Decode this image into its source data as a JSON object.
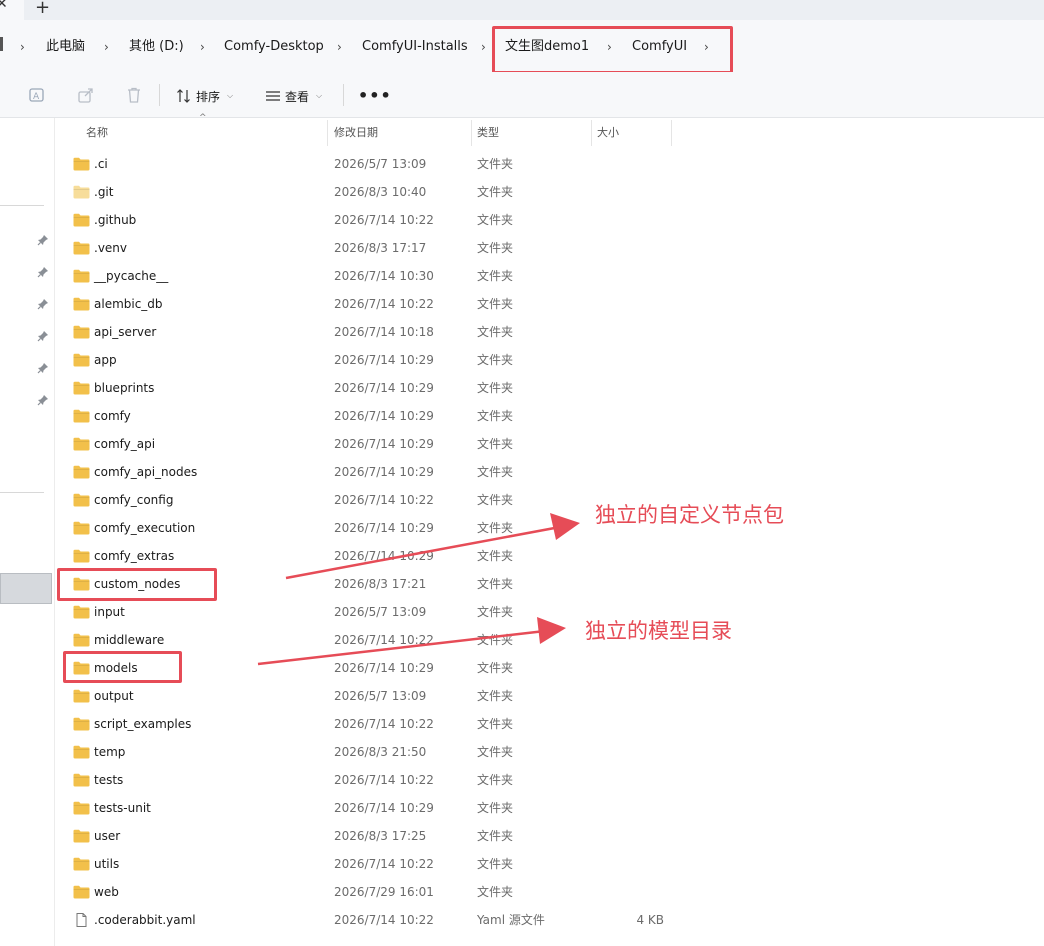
{
  "tabstrip": {
    "close_glyph": "✕",
    "new_tab_glyph": "+"
  },
  "breadcrumb": {
    "items": [
      "此电脑",
      "其他 (D:)",
      "Comfy-Desktop",
      "ComfyUI-Installs",
      "文生图demo1",
      "ComfyUI"
    ],
    "separator": "›"
  },
  "toolbar": {
    "icons": [
      "rename-icon",
      "share-icon",
      "delete-icon"
    ],
    "sort_label": "排序",
    "view_label": "查看",
    "more_label": "•••"
  },
  "columns": {
    "name": "名称",
    "date": "修改日期",
    "type": "类型",
    "size": "大小"
  },
  "files": [
    {
      "name": ".ci",
      "date": "2026/5/7 13:09",
      "type": "文件夹",
      "size": "",
      "kind": "folder"
    },
    {
      "name": ".git",
      "date": "2026/8/3 10:40",
      "type": "文件夹",
      "size": "",
      "kind": "folder-hidden"
    },
    {
      "name": ".github",
      "date": "2026/7/14 10:22",
      "type": "文件夹",
      "size": "",
      "kind": "folder"
    },
    {
      "name": ".venv",
      "date": "2026/8/3 17:17",
      "type": "文件夹",
      "size": "",
      "kind": "folder"
    },
    {
      "name": "__pycache__",
      "date": "2026/7/14 10:30",
      "type": "文件夹",
      "size": "",
      "kind": "folder"
    },
    {
      "name": "alembic_db",
      "date": "2026/7/14 10:22",
      "type": "文件夹",
      "size": "",
      "kind": "folder"
    },
    {
      "name": "api_server",
      "date": "2026/7/14 10:18",
      "type": "文件夹",
      "size": "",
      "kind": "folder"
    },
    {
      "name": "app",
      "date": "2026/7/14 10:29",
      "type": "文件夹",
      "size": "",
      "kind": "folder"
    },
    {
      "name": "blueprints",
      "date": "2026/7/14 10:29",
      "type": "文件夹",
      "size": "",
      "kind": "folder"
    },
    {
      "name": "comfy",
      "date": "2026/7/14 10:29",
      "type": "文件夹",
      "size": "",
      "kind": "folder"
    },
    {
      "name": "comfy_api",
      "date": "2026/7/14 10:29",
      "type": "文件夹",
      "size": "",
      "kind": "folder"
    },
    {
      "name": "comfy_api_nodes",
      "date": "2026/7/14 10:29",
      "type": "文件夹",
      "size": "",
      "kind": "folder"
    },
    {
      "name": "comfy_config",
      "date": "2026/7/14 10:22",
      "type": "文件夹",
      "size": "",
      "kind": "folder"
    },
    {
      "name": "comfy_execution",
      "date": "2026/7/14 10:29",
      "type": "文件夹",
      "size": "",
      "kind": "folder"
    },
    {
      "name": "comfy_extras",
      "date": "2026/7/14 10:29",
      "type": "文件夹",
      "size": "",
      "kind": "folder"
    },
    {
      "name": "custom_nodes",
      "date": "2026/8/3 17:21",
      "type": "文件夹",
      "size": "",
      "kind": "folder"
    },
    {
      "name": "input",
      "date": "2026/5/7 13:09",
      "type": "文件夹",
      "size": "",
      "kind": "folder"
    },
    {
      "name": "middleware",
      "date": "2026/7/14 10:22",
      "type": "文件夹",
      "size": "",
      "kind": "folder"
    },
    {
      "name": "models",
      "date": "2026/7/14 10:29",
      "type": "文件夹",
      "size": "",
      "kind": "folder"
    },
    {
      "name": "output",
      "date": "2026/5/7 13:09",
      "type": "文件夹",
      "size": "",
      "kind": "folder"
    },
    {
      "name": "script_examples",
      "date": "2026/7/14 10:22",
      "type": "文件夹",
      "size": "",
      "kind": "folder"
    },
    {
      "name": "temp",
      "date": "2026/8/3 21:50",
      "type": "文件夹",
      "size": "",
      "kind": "folder"
    },
    {
      "name": "tests",
      "date": "2026/7/14 10:22",
      "type": "文件夹",
      "size": "",
      "kind": "folder"
    },
    {
      "name": "tests-unit",
      "date": "2026/7/14 10:29",
      "type": "文件夹",
      "size": "",
      "kind": "folder"
    },
    {
      "name": "user",
      "date": "2026/8/3 17:25",
      "type": "文件夹",
      "size": "",
      "kind": "folder"
    },
    {
      "name": "utils",
      "date": "2026/7/14 10:22",
      "type": "文件夹",
      "size": "",
      "kind": "folder"
    },
    {
      "name": "web",
      "date": "2026/7/29 16:01",
      "type": "文件夹",
      "size": "",
      "kind": "folder"
    },
    {
      "name": ".coderabbit.yaml",
      "date": "2026/7/14 10:22",
      "type": "Yaml 源文件",
      "size": "4 KB",
      "kind": "file"
    }
  ],
  "annotations": {
    "custom_nodes_note": "独立的自定义节点包",
    "models_note": "独立的模型目录",
    "color": "#e64c57"
  },
  "colors": {
    "folder": "#f2c04a",
    "folder_hidden": "#f7dd9a",
    "accent": "#e64c57"
  }
}
